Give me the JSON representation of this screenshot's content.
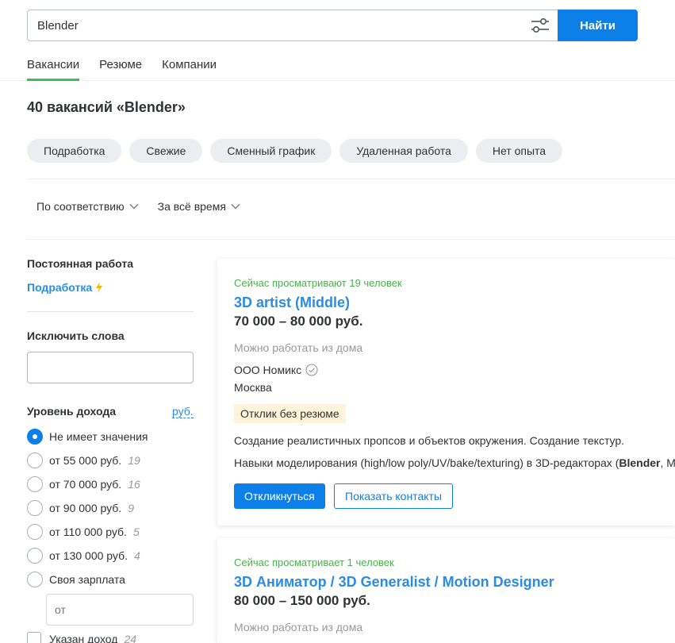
{
  "search": {
    "query": "Blender",
    "button_label": "Найти",
    "filter_icon": "filter-sliders-icon"
  },
  "tabs": [
    {
      "label": "Вакансии",
      "active": true
    },
    {
      "label": "Резюме",
      "active": false
    },
    {
      "label": "Компании",
      "active": false
    }
  ],
  "results_title": "40 вакансий «Blender»",
  "chips": [
    "Подработка",
    "Свежие",
    "Сменный график",
    "Удаленная работа",
    "Нет опыта"
  ],
  "sort": {
    "order": "По соответствию",
    "period": "За всё время"
  },
  "sidebar": {
    "permanent_heading": "Постоянная работа",
    "parttime_link": "Подработка",
    "exclude_heading": "Исключить слова",
    "income_heading": "Уровень дохода",
    "currency_link": "руб.",
    "income_options": [
      {
        "label": "Не имеет значения",
        "count": "",
        "checked": true
      },
      {
        "label": "от 55 000 руб.",
        "count": "19",
        "checked": false
      },
      {
        "label": "от 70 000 руб.",
        "count": "16",
        "checked": false
      },
      {
        "label": "от 90 000 руб.",
        "count": "9",
        "checked": false
      },
      {
        "label": "от 110 000 руб.",
        "count": "5",
        "checked": false
      },
      {
        "label": "от 130 000 руб.",
        "count": "4",
        "checked": false
      },
      {
        "label": "Своя зарплата",
        "count": "",
        "checked": false
      }
    ],
    "custom_salary_placeholder": "от",
    "income_specified": {
      "label": "Указан доход",
      "count": "24"
    }
  },
  "vacancies": [
    {
      "viewers": "Сейчас просматривают 19 человек",
      "title": "3D artist (Middle)",
      "salary": "70 000 – 80 000 руб.",
      "remote": "Можно работать из дома",
      "company": "ООО Номикс",
      "city": "Москва",
      "badge": "Отклик без резюме",
      "desc1": "Создание реалистичных пропсов и объектов окружения. Создание текстур.",
      "desc2_before": "Навыки моделирования (high/low poly/UV/bake/texturing) в 3D-редакторах (",
      "desc2_bold": "Blender",
      "desc2_after": ", M",
      "apply_label": "Откликнуться",
      "contacts_label": "Показать контакты"
    },
    {
      "viewers": "Сейчас просматривает 1 человек",
      "title": "3D Аниматор / 3D Generalist / Motion Designer",
      "salary": "80 000 – 150 000 руб.",
      "remote": "Можно работать из дома"
    }
  ],
  "colors": {
    "accent_blue": "#0d7fe8",
    "link_blue": "#2a8ce4",
    "viewers_green": "#4bb24e",
    "tab_underline_green": "#3fbd55",
    "badge_bg": "#fff4d9",
    "chip_bg": "#eceef1"
  }
}
